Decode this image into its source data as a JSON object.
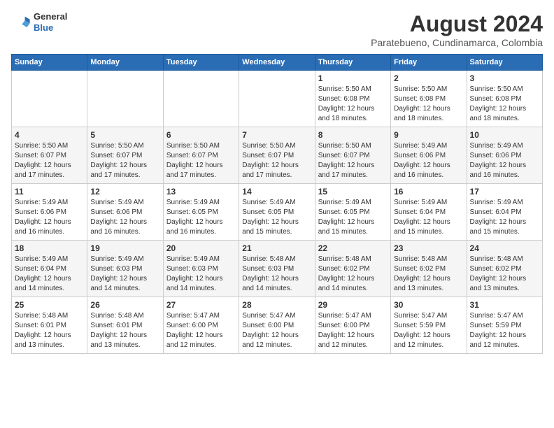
{
  "header": {
    "logo_line1": "General",
    "logo_line2": "Blue",
    "title": "August 2024",
    "subtitle": "Paratebueno, Cundinamarca, Colombia"
  },
  "calendar": {
    "days_of_week": [
      "Sunday",
      "Monday",
      "Tuesday",
      "Wednesday",
      "Thursday",
      "Friday",
      "Saturday"
    ],
    "weeks": [
      [
        {
          "day": "",
          "info": ""
        },
        {
          "day": "",
          "info": ""
        },
        {
          "day": "",
          "info": ""
        },
        {
          "day": "",
          "info": ""
        },
        {
          "day": "1",
          "info": "Sunrise: 5:50 AM\nSunset: 6:08 PM\nDaylight: 12 hours\nand 18 minutes."
        },
        {
          "day": "2",
          "info": "Sunrise: 5:50 AM\nSunset: 6:08 PM\nDaylight: 12 hours\nand 18 minutes."
        },
        {
          "day": "3",
          "info": "Sunrise: 5:50 AM\nSunset: 6:08 PM\nDaylight: 12 hours\nand 18 minutes."
        }
      ],
      [
        {
          "day": "4",
          "info": "Sunrise: 5:50 AM\nSunset: 6:07 PM\nDaylight: 12 hours\nand 17 minutes."
        },
        {
          "day": "5",
          "info": "Sunrise: 5:50 AM\nSunset: 6:07 PM\nDaylight: 12 hours\nand 17 minutes."
        },
        {
          "day": "6",
          "info": "Sunrise: 5:50 AM\nSunset: 6:07 PM\nDaylight: 12 hours\nand 17 minutes."
        },
        {
          "day": "7",
          "info": "Sunrise: 5:50 AM\nSunset: 6:07 PM\nDaylight: 12 hours\nand 17 minutes."
        },
        {
          "day": "8",
          "info": "Sunrise: 5:50 AM\nSunset: 6:07 PM\nDaylight: 12 hours\nand 17 minutes."
        },
        {
          "day": "9",
          "info": "Sunrise: 5:49 AM\nSunset: 6:06 PM\nDaylight: 12 hours\nand 16 minutes."
        },
        {
          "day": "10",
          "info": "Sunrise: 5:49 AM\nSunset: 6:06 PM\nDaylight: 12 hours\nand 16 minutes."
        }
      ],
      [
        {
          "day": "11",
          "info": "Sunrise: 5:49 AM\nSunset: 6:06 PM\nDaylight: 12 hours\nand 16 minutes."
        },
        {
          "day": "12",
          "info": "Sunrise: 5:49 AM\nSunset: 6:06 PM\nDaylight: 12 hours\nand 16 minutes."
        },
        {
          "day": "13",
          "info": "Sunrise: 5:49 AM\nSunset: 6:05 PM\nDaylight: 12 hours\nand 16 minutes."
        },
        {
          "day": "14",
          "info": "Sunrise: 5:49 AM\nSunset: 6:05 PM\nDaylight: 12 hours\nand 15 minutes."
        },
        {
          "day": "15",
          "info": "Sunrise: 5:49 AM\nSunset: 6:05 PM\nDaylight: 12 hours\nand 15 minutes."
        },
        {
          "day": "16",
          "info": "Sunrise: 5:49 AM\nSunset: 6:04 PM\nDaylight: 12 hours\nand 15 minutes."
        },
        {
          "day": "17",
          "info": "Sunrise: 5:49 AM\nSunset: 6:04 PM\nDaylight: 12 hours\nand 15 minutes."
        }
      ],
      [
        {
          "day": "18",
          "info": "Sunrise: 5:49 AM\nSunset: 6:04 PM\nDaylight: 12 hours\nand 14 minutes."
        },
        {
          "day": "19",
          "info": "Sunrise: 5:49 AM\nSunset: 6:03 PM\nDaylight: 12 hours\nand 14 minutes."
        },
        {
          "day": "20",
          "info": "Sunrise: 5:49 AM\nSunset: 6:03 PM\nDaylight: 12 hours\nand 14 minutes."
        },
        {
          "day": "21",
          "info": "Sunrise: 5:48 AM\nSunset: 6:03 PM\nDaylight: 12 hours\nand 14 minutes."
        },
        {
          "day": "22",
          "info": "Sunrise: 5:48 AM\nSunset: 6:02 PM\nDaylight: 12 hours\nand 14 minutes."
        },
        {
          "day": "23",
          "info": "Sunrise: 5:48 AM\nSunset: 6:02 PM\nDaylight: 12 hours\nand 13 minutes."
        },
        {
          "day": "24",
          "info": "Sunrise: 5:48 AM\nSunset: 6:02 PM\nDaylight: 12 hours\nand 13 minutes."
        }
      ],
      [
        {
          "day": "25",
          "info": "Sunrise: 5:48 AM\nSunset: 6:01 PM\nDaylight: 12 hours\nand 13 minutes."
        },
        {
          "day": "26",
          "info": "Sunrise: 5:48 AM\nSunset: 6:01 PM\nDaylight: 12 hours\nand 13 minutes."
        },
        {
          "day": "27",
          "info": "Sunrise: 5:47 AM\nSunset: 6:00 PM\nDaylight: 12 hours\nand 12 minutes."
        },
        {
          "day": "28",
          "info": "Sunrise: 5:47 AM\nSunset: 6:00 PM\nDaylight: 12 hours\nand 12 minutes."
        },
        {
          "day": "29",
          "info": "Sunrise: 5:47 AM\nSunset: 6:00 PM\nDaylight: 12 hours\nand 12 minutes."
        },
        {
          "day": "30",
          "info": "Sunrise: 5:47 AM\nSunset: 5:59 PM\nDaylight: 12 hours\nand 12 minutes."
        },
        {
          "day": "31",
          "info": "Sunrise: 5:47 AM\nSunset: 5:59 PM\nDaylight: 12 hours\nand 12 minutes."
        }
      ]
    ]
  }
}
